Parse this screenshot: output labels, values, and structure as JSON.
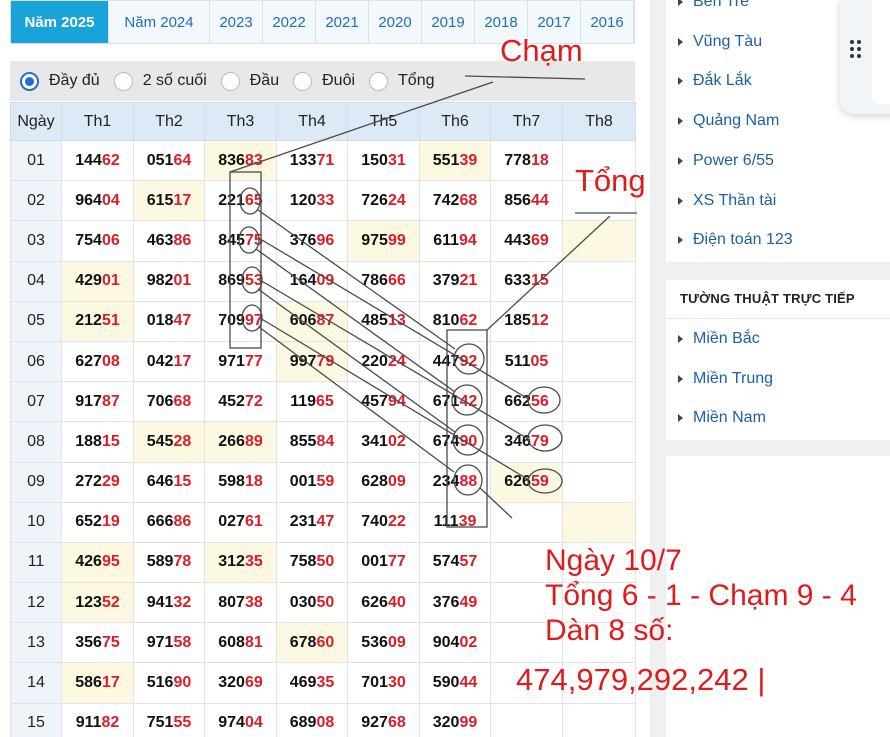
{
  "years": [
    "Năm 2025",
    "Năm 2024",
    "2023",
    "2022",
    "2021",
    "2020",
    "2019",
    "2018",
    "2017",
    "2016"
  ],
  "options": [
    "Đầy đủ",
    "2 số cuối",
    "Đầu",
    "Đuôi",
    "Tổng"
  ],
  "selected_option": "Đầy đủ",
  "table": {
    "headers": [
      "Ngày",
      "Th1",
      "Th2",
      "Th3",
      "Th4",
      "Th5",
      "Th6",
      "Th7",
      "Th8"
    ],
    "rows": [
      {
        "day": "01",
        "cells": [
          "14462",
          "05164",
          "83683",
          "13371",
          "15031",
          "55139",
          "77818",
          ""
        ]
      },
      {
        "day": "02",
        "cells": [
          "96404",
          "61517",
          "22165",
          "12033",
          "72624",
          "74268",
          "85644",
          ""
        ]
      },
      {
        "day": "03",
        "cells": [
          "75406",
          "46386",
          "84575",
          "37696",
          "97599",
          "61194",
          "44369",
          ""
        ]
      },
      {
        "day": "04",
        "cells": [
          "42901",
          "98201",
          "86953",
          "16409",
          "78666",
          "37921",
          "63315",
          ""
        ]
      },
      {
        "day": "05",
        "cells": [
          "21251",
          "01847",
          "70997",
          "60687",
          "48513",
          "81062",
          "18512",
          ""
        ]
      },
      {
        "day": "06",
        "cells": [
          "62708",
          "04217",
          "97177",
          "99779",
          "22024",
          "44792",
          "51105",
          ""
        ]
      },
      {
        "day": "07",
        "cells": [
          "91787",
          "70668",
          "45272",
          "11965",
          "45794",
          "67142",
          "66256",
          ""
        ]
      },
      {
        "day": "08",
        "cells": [
          "18815",
          "54528",
          "26689",
          "85584",
          "34102",
          "67490",
          "34679",
          ""
        ]
      },
      {
        "day": "09",
        "cells": [
          "27229",
          "64615",
          "59818",
          "00159",
          "62809",
          "23488",
          "62659",
          ""
        ]
      },
      {
        "day": "10",
        "cells": [
          "65219",
          "66686",
          "02761",
          "23147",
          "74022",
          "11139",
          "",
          ""
        ]
      },
      {
        "day": "11",
        "cells": [
          "42695",
          "58978",
          "31235",
          "75850",
          "00177",
          "57457",
          "",
          ""
        ]
      },
      {
        "day": "12",
        "cells": [
          "12352",
          "94132",
          "80738",
          "03050",
          "62640",
          "37649",
          "",
          ""
        ]
      },
      {
        "day": "13",
        "cells": [
          "35675",
          "97158",
          "60881",
          "67860",
          "53609",
          "90402",
          "",
          ""
        ]
      },
      {
        "day": "14",
        "cells": [
          "58617",
          "51690",
          "32069",
          "46935",
          "70130",
          "59044",
          "",
          ""
        ]
      },
      {
        "day": "15",
        "cells": [
          "91182",
          "75155",
          "97404",
          "68908",
          "92768",
          "32099",
          "",
          ""
        ]
      }
    ]
  },
  "annotations": {
    "cham": "Chạm",
    "tong": "Tổng",
    "line1": "Ngày 10/7",
    "line2": "Tổng 6 - 1 - Chạm 9 - 4",
    "line3": "Dàn 8 số:",
    "dan": "474,979,292,242 |"
  },
  "sidebar": {
    "provinces": [
      "Bến Tre",
      "Vũng Tàu",
      "Đắk Lắk",
      "Quảng Nam",
      "Power 6/55",
      "XS Thần tài",
      "Điện toán 123"
    ],
    "live_title": "TƯỜNG THUẬT TRỰC TIẾP",
    "live_links": [
      "Miền Bắc",
      "Miền Trung",
      "Miền Nam"
    ]
  },
  "colors": {
    "accent": "#1aa3d8",
    "red": "#d91f26",
    "header_bg": "#dbeaf6",
    "highlight_bg": "#fdf8e2"
  }
}
